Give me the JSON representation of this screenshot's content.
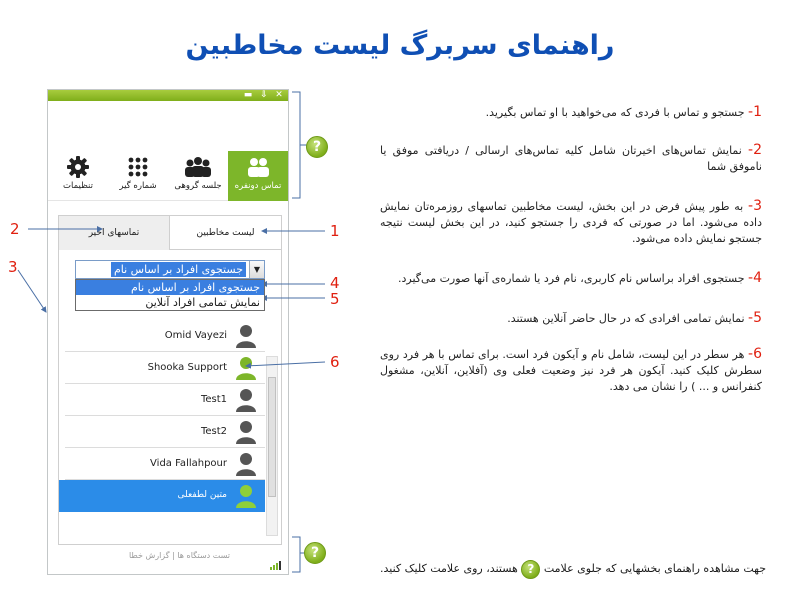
{
  "page_title": "راهنمای سربرگ لیست مخاطبین",
  "window": {
    "controls": [
      "▬",
      "⇩",
      "✕"
    ],
    "toolbar": [
      {
        "label": "تماس دونفره",
        "icon": "two-person-icon",
        "active": true
      },
      {
        "label": "جلسه گروهی",
        "icon": "group-icon",
        "active": false
      },
      {
        "label": "شماره گیر",
        "icon": "dialpad-icon",
        "active": false
      },
      {
        "label": "تنظیمات",
        "icon": "gear-icon",
        "active": false
      }
    ],
    "tabs": [
      {
        "label": "لیست مخاطبین",
        "active": true
      },
      {
        "label": "تماسهای اخیر",
        "active": false
      }
    ],
    "search_select": {
      "value": "جستجوی افراد بر اساس نام",
      "options": [
        "جستجوی افراد بر اساس نام",
        "نمایش تمامی افراد آنلاین"
      ]
    },
    "contacts": [
      {
        "name": "Omid Vayezi",
        "status": "offline"
      },
      {
        "name": "Shooka Support",
        "status": "online"
      },
      {
        "name": "Test1",
        "status": "offline"
      },
      {
        "name": "Test2",
        "status": "offline"
      },
      {
        "name": "Vida Fallahpour",
        "status": "offline"
      },
      {
        "name": "متین لطفعلی",
        "status": "online",
        "selected": true
      }
    ],
    "footer": {
      "test_devices": "تست دستگاه ها",
      "separator": "|",
      "report_error": "گزارش خطا"
    }
  },
  "callouts": [
    "1",
    "2",
    "3",
    "4",
    "5",
    "6"
  ],
  "help_symbol": "?",
  "notes": [
    {
      "num": "1-",
      "text": "جستجو و تماس با فردی که می‌خواهید با او تماس بگیرید."
    },
    {
      "num": "2-",
      "text": "نمایش تماس‌های اخیرتان شامل کلیه تماس‌های ارسالی / دریافتی موفق یا ناموفق شما"
    },
    {
      "num": "3-",
      "text": "به طور پیش فرض در این بخش، لیست مخاطبین تماسهای روزمره‌تان نمایش داده می‌شود. اما در صورتی که فردی را جستجو کنید، در این بخش لیست نتیجه جستجو نمایش داده می‌شود."
    },
    {
      "num": "4-",
      "text": "جستجوی افراد براساس نام کاربری، نام فرد یا شماره‌ی آنها صورت می‌گیرد."
    },
    {
      "num": "5-",
      "text": "نمایش تمامی افرادی که در حال حاضر آنلاین هستند."
    },
    {
      "num": "6-",
      "text": "هر سطر در این لیست، شامل نام و آیکون فرد است. برای تماس با هر فرد روی سطرش کلیک کنید. آیکون هر فرد نیز وضعیت فعلی وی (آفلاین، آنلاین، مشغول کنفرانس و ... ) را نشان می دهد."
    }
  ],
  "bottom_note": {
    "before": "جهت مشاهده راهنمای بخشهایی که جلوی علامت",
    "after": "هستند، روی علامت کلیک کنید."
  },
  "colors": {
    "title": "#0f4fb4",
    "accent_green": "#7db62a",
    "callout_red": "#e02010",
    "selected_row": "#2b8ce8"
  }
}
